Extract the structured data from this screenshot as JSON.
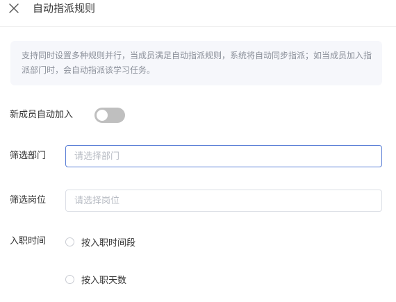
{
  "header": {
    "title": "自动指派规则",
    "close_icon": "close-icon"
  },
  "notice": {
    "text": "支持同时设置多种规则并行，当成员满足自动指派规则，系统将自动同步指派；如当成员加入指派部门时，会自动指派该学习任务。"
  },
  "form": {
    "auto_join": {
      "label": "新成员自动加入",
      "enabled": false
    },
    "department": {
      "label": "筛选部门",
      "placeholder": "请选择部门"
    },
    "position": {
      "label": "筛选岗位",
      "placeholder": "请选择岗位"
    },
    "hire_time": {
      "label": "入职时间",
      "options": [
        {
          "label": "按入职时间段",
          "selected": false
        },
        {
          "label": "按入职天数",
          "selected": false
        }
      ]
    }
  },
  "colors": {
    "toggle_off": "#bfbfbf",
    "focus_border": "#5b7fd6",
    "notice_bg": "#f6f7fb"
  }
}
